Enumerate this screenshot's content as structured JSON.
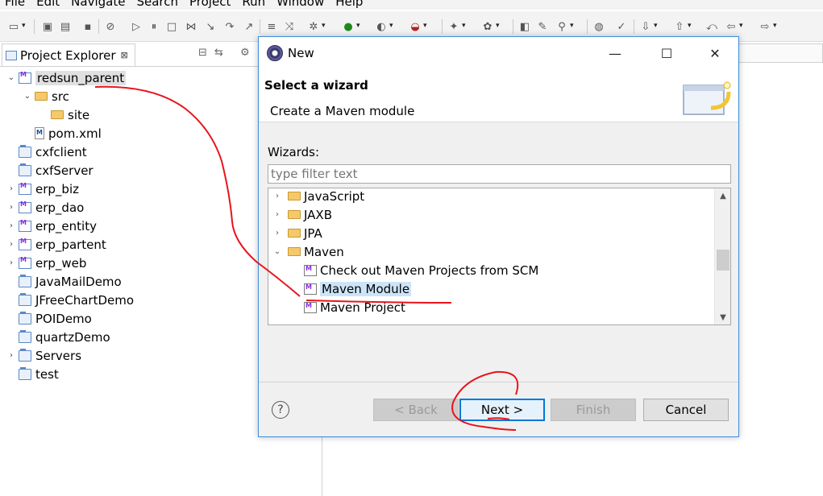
{
  "menubar": {
    "items": [
      "File",
      "Edit",
      "Navigate",
      "Search",
      "Project",
      "Run",
      "Window",
      "Help"
    ]
  },
  "explorer": {
    "tab_title": "Project Explorer",
    "tab_close": "⊠",
    "tree": [
      {
        "label": "redsun_parent",
        "icon": "maven-project-icon",
        "twisty": "⌄",
        "depth": 0,
        "selected": true
      },
      {
        "label": "src",
        "icon": "folder-icon",
        "twisty": "⌄",
        "depth": 1
      },
      {
        "label": "site",
        "icon": "folder-icon",
        "twisty": "",
        "depth": 2
      },
      {
        "label": "pom.xml",
        "icon": "pom-file-icon",
        "twisty": "",
        "depth": 1
      },
      {
        "label": "cxfclient",
        "icon": "project-icon",
        "twisty": "",
        "depth": 0
      },
      {
        "label": "cxfServer",
        "icon": "project-icon",
        "twisty": "",
        "depth": 0
      },
      {
        "label": "erp_biz",
        "icon": "maven-project-icon",
        "twisty": "›",
        "depth": 0
      },
      {
        "label": "erp_dao",
        "icon": "maven-project-icon",
        "twisty": "›",
        "depth": 0
      },
      {
        "label": "erp_entity",
        "icon": "maven-project-icon",
        "twisty": "›",
        "depth": 0
      },
      {
        "label": "erp_partent",
        "icon": "maven-project-icon",
        "twisty": "›",
        "depth": 0
      },
      {
        "label": "erp_web",
        "icon": "maven-project-icon",
        "twisty": "›",
        "depth": 0
      },
      {
        "label": "JavaMailDemo",
        "icon": "project-icon",
        "twisty": "",
        "depth": 0
      },
      {
        "label": "JFreeChartDemo",
        "icon": "project-icon",
        "twisty": "",
        "depth": 0
      },
      {
        "label": "POIDemo",
        "icon": "project-icon",
        "twisty": "",
        "depth": 0
      },
      {
        "label": "quartzDemo",
        "icon": "project-icon",
        "twisty": "",
        "depth": 0
      },
      {
        "label": "Servers",
        "icon": "project-icon",
        "twisty": "›",
        "depth": 0
      },
      {
        "label": "test",
        "icon": "project-icon",
        "twisty": "",
        "depth": 0
      }
    ]
  },
  "dialog": {
    "title": "New",
    "header_title": "Select a wizard",
    "header_desc": "Create a Maven module",
    "wizards_label": "Wizards:",
    "filter_placeholder": "type filter text",
    "list": [
      {
        "label": "JavaScript",
        "icon": "folder-icon",
        "twisty": "›",
        "depth": 0
      },
      {
        "label": "JAXB",
        "icon": "folder-icon",
        "twisty": "›",
        "depth": 0
      },
      {
        "label": "JPA",
        "icon": "folder-icon",
        "twisty": "›",
        "depth": 0
      },
      {
        "label": "Maven",
        "icon": "folder-icon",
        "twisty": "⌄",
        "depth": 0
      },
      {
        "label": "Check out Maven Projects from SCM",
        "icon": "maven-wizard-icon",
        "twisty": "",
        "depth": 1
      },
      {
        "label": "Maven Module",
        "icon": "maven-wizard-icon",
        "twisty": "",
        "depth": 1,
        "selected": true
      },
      {
        "label": "Maven Project",
        "icon": "maven-wizard-icon",
        "twisty": "",
        "depth": 1
      }
    ],
    "buttons": {
      "help": "?",
      "back": "< Back",
      "next": "Next >",
      "finish": "Finish",
      "cancel": "Cancel"
    },
    "window_controls": {
      "minimize": "—",
      "maximize": "☐",
      "close": "✕"
    }
  },
  "colors": {
    "accent": "#0078d7",
    "annotation": "#e8141c",
    "selection": "#cce4f7"
  }
}
